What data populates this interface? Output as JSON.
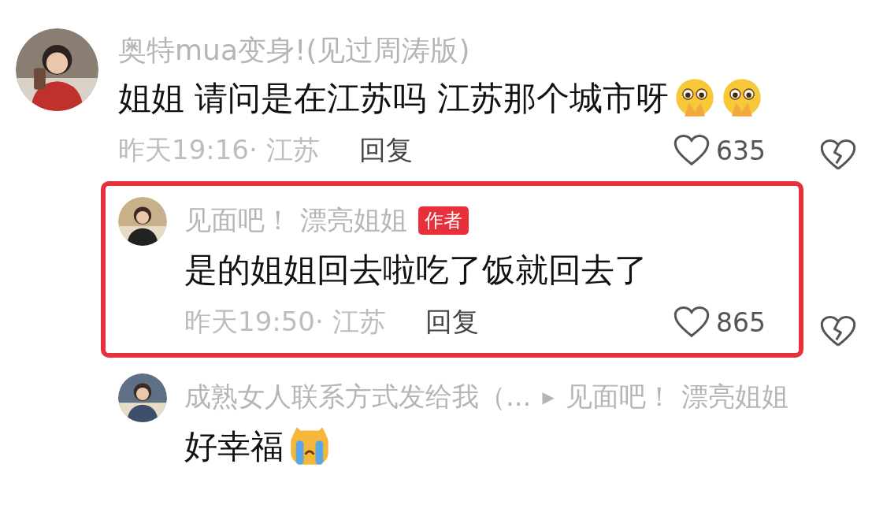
{
  "comments": [
    {
      "kind": "top",
      "highlighted": false,
      "user": "奥特mua变身!(见过周涛版)",
      "text": "姐姐 请问是在江苏吗 江苏那个城市呀",
      "emojis": [
        {
          "kind": "pleading"
        },
        {
          "kind": "pleading"
        }
      ],
      "time": "昨天19:16· 江苏",
      "reply_label": "回复",
      "likes": "635"
    },
    {
      "kind": "reply",
      "highlighted": true,
      "user": "见面吧！ 漂亮姐姐",
      "badge": "作者",
      "text": "是的姐姐回去啦吃了饭就回去了",
      "time": "昨天19:50· 江苏",
      "reply_label": "回复",
      "likes": "865"
    },
    {
      "kind": "reply",
      "highlighted": false,
      "user": "成熟女人联系方式发给我（...",
      "reply_arrow": "▶",
      "reply_to": "见面吧！ 漂亮姐姐",
      "text": "好幸福",
      "emojis": [
        {
          "kind": "crying"
        }
      ]
    }
  ]
}
